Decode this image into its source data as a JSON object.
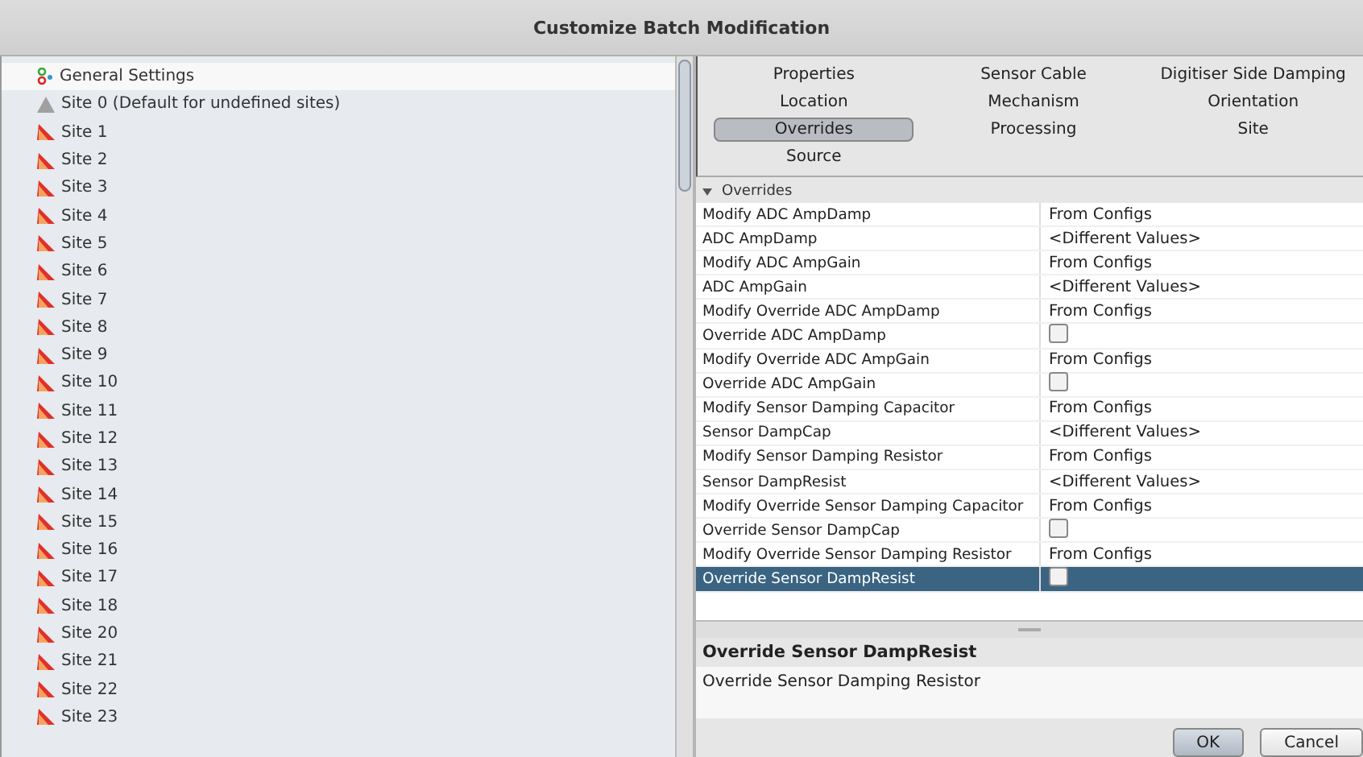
{
  "window": {
    "title": "Customize Batch Modification"
  },
  "sidebar": {
    "items": [
      {
        "kind": "general",
        "label": "General Settings",
        "selected": true
      },
      {
        "kind": "default",
        "label": "Site 0 (Default for undefined sites)",
        "selected": false
      },
      {
        "kind": "site",
        "label": "Site 1",
        "selected": false
      },
      {
        "kind": "site",
        "label": "Site 2",
        "selected": false
      },
      {
        "kind": "site",
        "label": "Site 3",
        "selected": false
      },
      {
        "kind": "site",
        "label": "Site 4",
        "selected": false
      },
      {
        "kind": "site",
        "label": "Site 5",
        "selected": false
      },
      {
        "kind": "site",
        "label": "Site 6",
        "selected": false
      },
      {
        "kind": "site",
        "label": "Site 7",
        "selected": false
      },
      {
        "kind": "site",
        "label": "Site 8",
        "selected": false
      },
      {
        "kind": "site",
        "label": "Site 9",
        "selected": false
      },
      {
        "kind": "site",
        "label": "Site 10",
        "selected": false
      },
      {
        "kind": "site",
        "label": "Site 11",
        "selected": false
      },
      {
        "kind": "site",
        "label": "Site 12",
        "selected": false
      },
      {
        "kind": "site",
        "label": "Site 13",
        "selected": false
      },
      {
        "kind": "site",
        "label": "Site 14",
        "selected": false
      },
      {
        "kind": "site",
        "label": "Site 15",
        "selected": false
      },
      {
        "kind": "site",
        "label": "Site 16",
        "selected": false
      },
      {
        "kind": "site",
        "label": "Site 17",
        "selected": false
      },
      {
        "kind": "site",
        "label": "Site 18",
        "selected": false
      },
      {
        "kind": "site",
        "label": "Site 20",
        "selected": false
      },
      {
        "kind": "site",
        "label": "Site 21",
        "selected": false
      },
      {
        "kind": "site",
        "label": "Site 22",
        "selected": false
      },
      {
        "kind": "site",
        "label": "Site 23",
        "selected": false
      }
    ]
  },
  "tabs": [
    {
      "label": "Properties",
      "selected": false
    },
    {
      "label": "Sensor Cable",
      "selected": false
    },
    {
      "label": "Digitiser Side Damping",
      "selected": false
    },
    {
      "label": "Location",
      "selected": false
    },
    {
      "label": "Mechanism",
      "selected": false
    },
    {
      "label": "Orientation",
      "selected": false
    },
    {
      "label": "Overrides",
      "selected": true
    },
    {
      "label": "Processing",
      "selected": false
    },
    {
      "label": "Site",
      "selected": false
    },
    {
      "label": "Source",
      "selected": false
    }
  ],
  "property_group": {
    "title": "Overrides",
    "expanded": true
  },
  "properties": [
    {
      "name": "Modify ADC AmpDamp",
      "kind": "combo",
      "value": "From Configs",
      "selected": false
    },
    {
      "name": "ADC AmpDamp",
      "kind": "text",
      "value": "<Different Values>",
      "selected": false
    },
    {
      "name": "Modify ADC AmpGain",
      "kind": "combo",
      "value": "From Configs",
      "selected": false
    },
    {
      "name": "ADC AmpGain",
      "kind": "text",
      "value": "<Different Values>",
      "selected": false
    },
    {
      "name": "Modify Override ADC AmpDamp",
      "kind": "combo",
      "value": "From Configs",
      "selected": false
    },
    {
      "name": "Override ADC AmpDamp",
      "kind": "checkbox",
      "checked": false,
      "selected": false
    },
    {
      "name": "Modify Override ADC AmpGain",
      "kind": "combo",
      "value": "From Configs",
      "selected": false
    },
    {
      "name": "Override ADC AmpGain",
      "kind": "checkbox",
      "checked": false,
      "selected": false
    },
    {
      "name": "Modify Sensor Damping Capacitor",
      "kind": "combo",
      "value": "From Configs",
      "selected": false
    },
    {
      "name": "Sensor DampCap",
      "kind": "text",
      "value": "<Different Values>",
      "selected": false
    },
    {
      "name": "Modify Sensor Damping Resistor",
      "kind": "combo",
      "value": "From Configs",
      "selected": false
    },
    {
      "name": "Sensor DampResist",
      "kind": "text",
      "value": "<Different Values>",
      "selected": false
    },
    {
      "name": "Modify Override Sensor Damping Capacitor",
      "kind": "combo",
      "value": "From Configs",
      "selected": false
    },
    {
      "name": "Override Sensor DampCap",
      "kind": "checkbox",
      "checked": false,
      "selected": false
    },
    {
      "name": "Modify Override Sensor Damping Resistor",
      "kind": "combo",
      "value": "From Configs",
      "selected": false
    },
    {
      "name": "Override Sensor DampResist",
      "kind": "checkbox",
      "checked": false,
      "selected": true
    }
  ],
  "description": {
    "title": "Override Sensor DampResist",
    "text": "Override Sensor Damping Resistor"
  },
  "buttons": [
    "OK",
    "Cancel"
  ]
}
